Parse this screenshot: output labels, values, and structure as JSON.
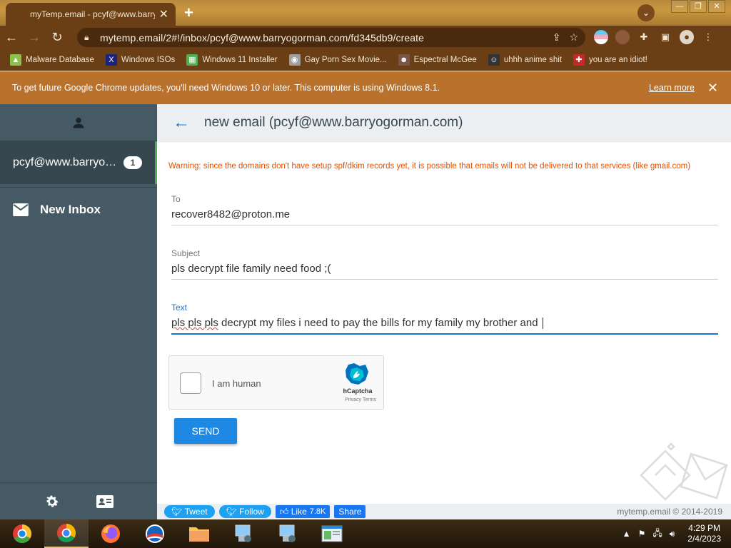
{
  "browser": {
    "tab_title": "myTemp.email - pcyf@www.barry",
    "tab_close": "✕",
    "new_tab": "+",
    "url": "mytemp.email/2#!/inbox/pcyf@www.barryogorman.com/fd345db9/create",
    "window_buttons": [
      "—",
      "❐",
      "✕"
    ]
  },
  "bookmarks": [
    {
      "label": "Malware Database",
      "color": "#8bc34a"
    },
    {
      "label": "Windows ISOs",
      "color": "#1a237e"
    },
    {
      "label": "Windows 11 Installer",
      "color": "#4caf50"
    },
    {
      "label": "Gay Porn Sex Movie...",
      "color": "#9e9e9e"
    },
    {
      "label": "Espectral McGee",
      "color": "#795548"
    },
    {
      "label": "uhhh anime shit",
      "color": "#333333"
    },
    {
      "label": "you are an idiot!",
      "color": "#c62828"
    }
  ],
  "infobar": {
    "message": "To get future Google Chrome updates, you'll need Windows 10 or later. This computer is using Windows 8.1.",
    "learn_more": "Learn more",
    "close": "✕"
  },
  "sidebar": {
    "account": "pcyf@www.barryogorman.com",
    "badge": "1",
    "inbox_label": "New Inbox"
  },
  "main": {
    "title": "new email (pcyf@www.barryogorman.com)",
    "warning": "Warning: since the domains don't have setup spf/dkim records yet, it is possible that emails will not be delivered to that services (like gmail.com)",
    "to_label": "To",
    "to_value": "recover8482@proton.me",
    "subject_label": "Subject",
    "subject_value": "pls decrypt file family need food ;(",
    "text_label": "Text",
    "text_misspelled": "pls pls pls",
    "text_value": " decrypt my files i need to pay the bills for my family my brother and ",
    "send_label": "SEND"
  },
  "captcha": {
    "label": "I am human",
    "brand": "hCaptcha",
    "links": "Privacy   Terms"
  },
  "footer": {
    "tweet": "Tweet",
    "follow": "Follow",
    "like": "Like",
    "like_count": "7.8K",
    "share": "Share",
    "copyright": "mytemp.email © 2014-2019"
  },
  "taskbar": {
    "time": "4:29 PM",
    "date": "2/4/2023"
  },
  "colors": {
    "sidebar_bg": "#455a64",
    "accent_blue": "#1976d2",
    "warning_orange": "#e65100",
    "infobar_bg": "#b9712c"
  }
}
